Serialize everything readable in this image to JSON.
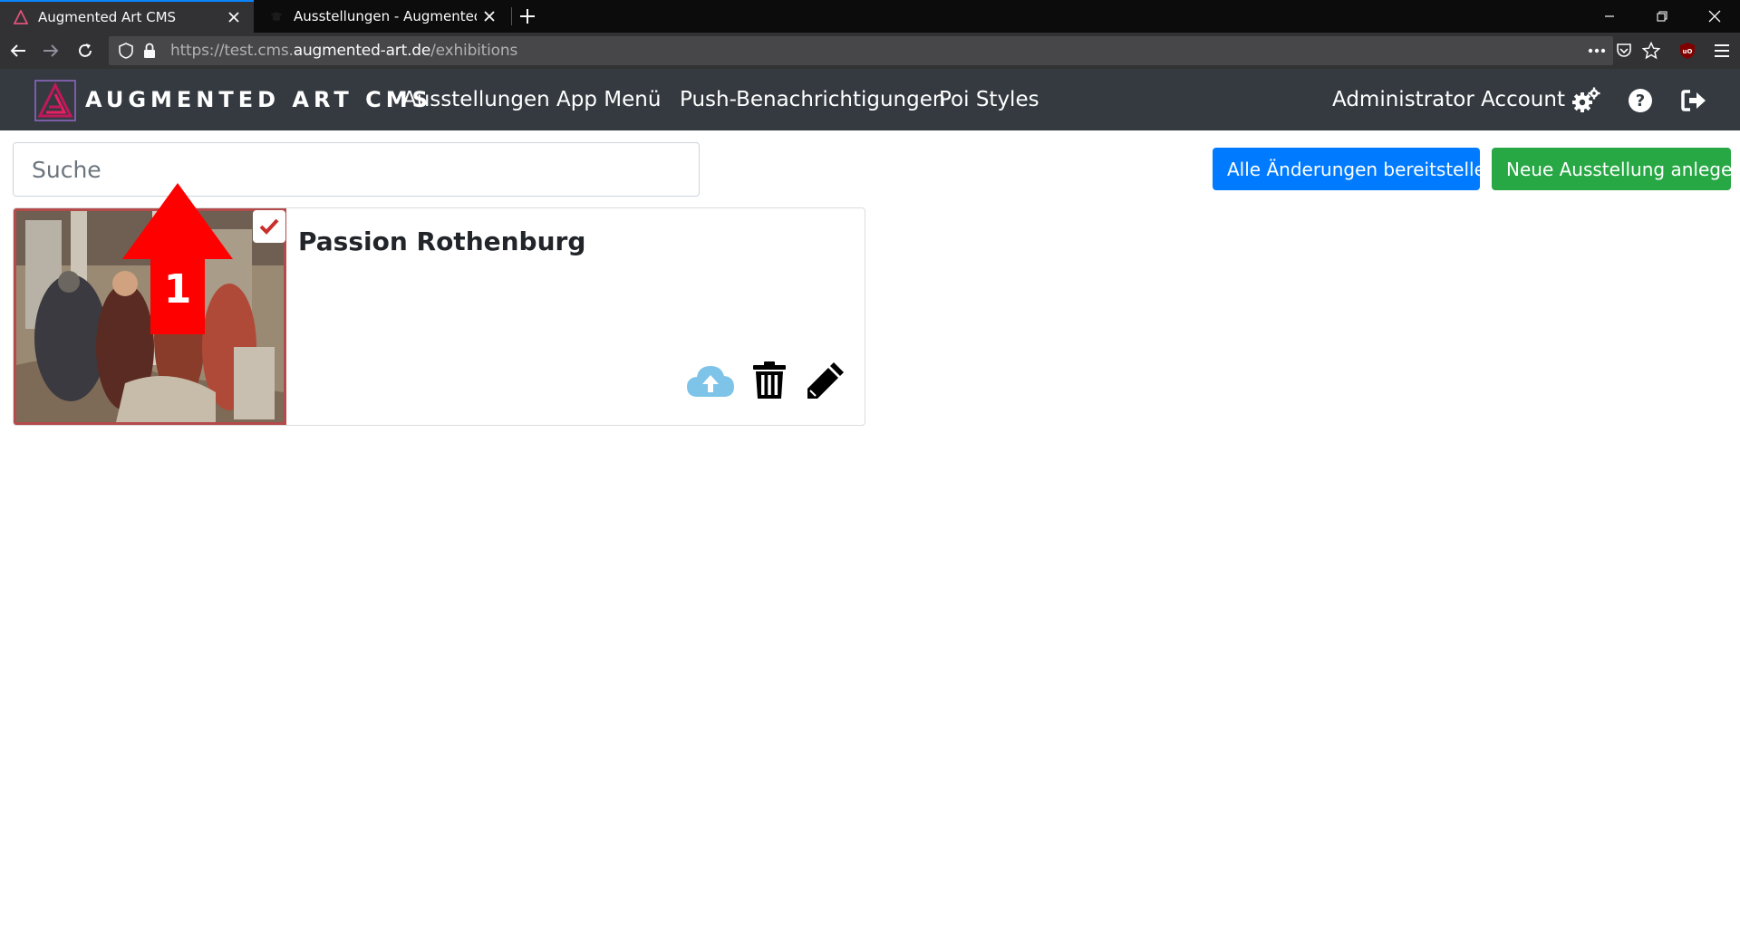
{
  "browser": {
    "tabs": [
      {
        "title": "Augmented Art CMS",
        "active": true
      },
      {
        "title": "Ausstellungen - Augmented Art",
        "active": false
      }
    ],
    "url": {
      "prefix": "https://test.cms.",
      "host": "augmented-art.de",
      "path": "/exhibitions"
    }
  },
  "app": {
    "brand": "AUGMENTED ART CMS",
    "nav": {
      "exhibitions": "Ausstellungen",
      "app_menu": "App Menü",
      "push": "Push-Benachrichtigungen",
      "poi_styles": "Poi Styles",
      "account": "Administrator Account"
    },
    "icons": [
      "gears-icon",
      "help-icon",
      "logout-icon"
    ]
  },
  "toolbar": {
    "search_placeholder": "Suche",
    "deploy_all_label": "Alle Änderungen bereitstellen",
    "new_exhibition_label": "Neue Ausstellung anlegen"
  },
  "exhibitions": [
    {
      "title": "Passion Rothenburg",
      "selected": true
    }
  ],
  "annotation": {
    "label": "1",
    "color": "#ff0000"
  },
  "colors": {
    "primary": "#007bff",
    "success": "#28a745",
    "navbar": "#343a40",
    "upload_icon": "#7ec4e8"
  }
}
